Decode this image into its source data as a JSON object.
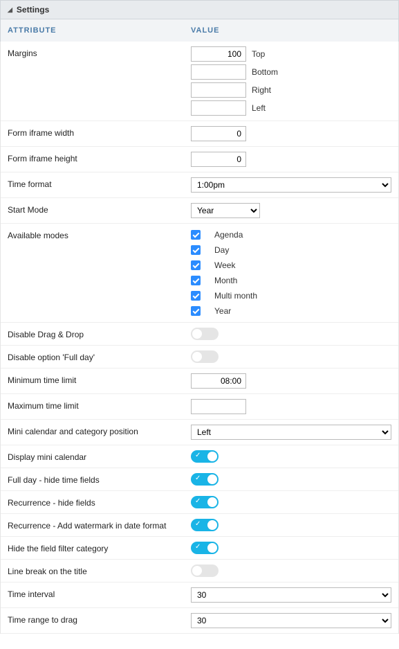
{
  "panel": {
    "title": "Settings"
  },
  "columns": {
    "attr": "ATTRIBUTE",
    "val": "VALUE"
  },
  "margins": {
    "label": "Margins",
    "top_value": "100",
    "top_label": "Top",
    "bottom_value": "",
    "bottom_label": "Bottom",
    "right_value": "",
    "right_label": "Right",
    "left_value": "",
    "left_label": "Left"
  },
  "form_iframe_width": {
    "label": "Form iframe width",
    "value": "0"
  },
  "form_iframe_height": {
    "label": "Form iframe height",
    "value": "0"
  },
  "time_format": {
    "label": "Time format",
    "value": "1:00pm"
  },
  "start_mode": {
    "label": "Start Mode",
    "value": "Year"
  },
  "available_modes": {
    "label": "Available modes",
    "items": [
      {
        "label": "Agenda",
        "checked": true
      },
      {
        "label": "Day",
        "checked": true
      },
      {
        "label": "Week",
        "checked": true
      },
      {
        "label": "Month",
        "checked": true
      },
      {
        "label": "Multi month",
        "checked": true
      },
      {
        "label": "Year",
        "checked": true
      }
    ]
  },
  "disable_drag_drop": {
    "label": "Disable Drag & Drop",
    "on": false
  },
  "disable_full_day": {
    "label": "Disable option 'Full day'",
    "on": false
  },
  "min_time_limit": {
    "label": "Minimum time limit",
    "value": "08:00"
  },
  "max_time_limit": {
    "label": "Maximum time limit",
    "value": ""
  },
  "mini_cal_position": {
    "label": "Mini calendar and category position",
    "value": "Left"
  },
  "display_mini_cal": {
    "label": "Display mini calendar",
    "on": true
  },
  "full_day_hide_time": {
    "label": "Full day - hide time fields",
    "on": true
  },
  "recurrence_hide": {
    "label": "Recurrence - hide fields",
    "on": true
  },
  "recurrence_watermark": {
    "label": "Recurrence - Add watermark in date format",
    "on": true
  },
  "hide_filter_category": {
    "label": "Hide the field filter category",
    "on": true
  },
  "line_break_title": {
    "label": "Line break on the title",
    "on": false
  },
  "time_interval": {
    "label": "Time interval",
    "value": "30"
  },
  "time_range_drag": {
    "label": "Time range to drag",
    "value": "30"
  }
}
